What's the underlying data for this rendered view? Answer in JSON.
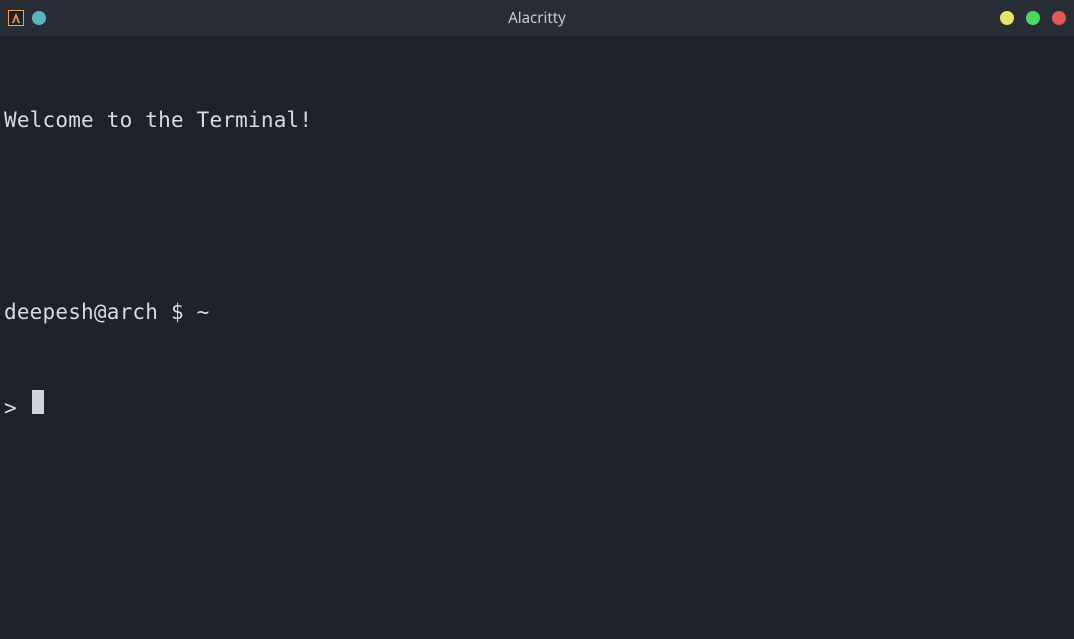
{
  "titlebar": {
    "title": "Alacritty"
  },
  "terminal": {
    "welcome": "Welcome to the Terminal!",
    "prompt": {
      "user": "deepesh",
      "at": "@",
      "host": "arch",
      "post_host": " $ ",
      "path": "~"
    },
    "secondary_prompt": "> "
  }
}
